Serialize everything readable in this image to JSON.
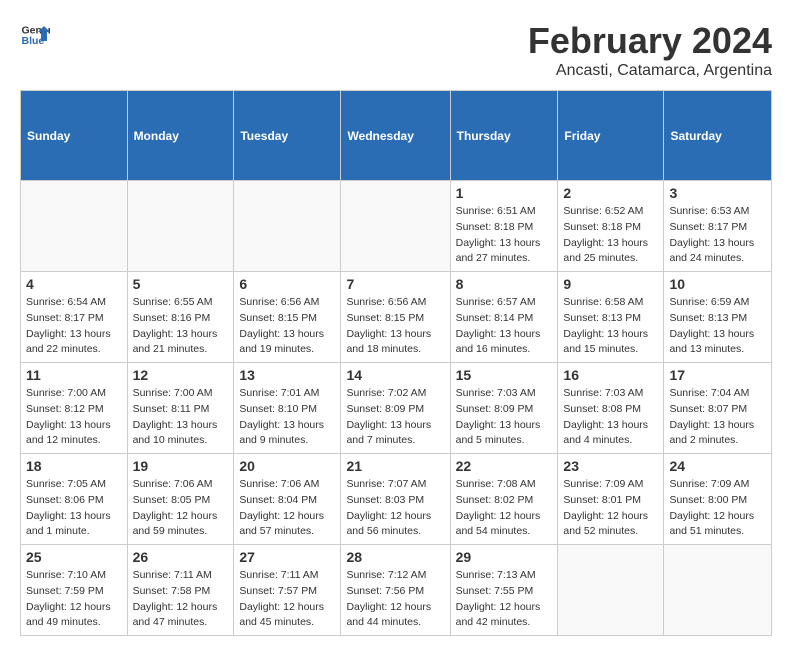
{
  "logo": {
    "line1": "General",
    "line2": "Blue"
  },
  "title": "February 2024",
  "location": "Ancasti, Catamarca, Argentina",
  "headers": [
    "Sunday",
    "Monday",
    "Tuesday",
    "Wednesday",
    "Thursday",
    "Friday",
    "Saturday"
  ],
  "weeks": [
    [
      {
        "day": "",
        "info": ""
      },
      {
        "day": "",
        "info": ""
      },
      {
        "day": "",
        "info": ""
      },
      {
        "day": "",
        "info": ""
      },
      {
        "day": "1",
        "info": "Sunrise: 6:51 AM\nSunset: 8:18 PM\nDaylight: 13 hours\nand 27 minutes."
      },
      {
        "day": "2",
        "info": "Sunrise: 6:52 AM\nSunset: 8:18 PM\nDaylight: 13 hours\nand 25 minutes."
      },
      {
        "day": "3",
        "info": "Sunrise: 6:53 AM\nSunset: 8:17 PM\nDaylight: 13 hours\nand 24 minutes."
      }
    ],
    [
      {
        "day": "4",
        "info": "Sunrise: 6:54 AM\nSunset: 8:17 PM\nDaylight: 13 hours\nand 22 minutes."
      },
      {
        "day": "5",
        "info": "Sunrise: 6:55 AM\nSunset: 8:16 PM\nDaylight: 13 hours\nand 21 minutes."
      },
      {
        "day": "6",
        "info": "Sunrise: 6:56 AM\nSunset: 8:15 PM\nDaylight: 13 hours\nand 19 minutes."
      },
      {
        "day": "7",
        "info": "Sunrise: 6:56 AM\nSunset: 8:15 PM\nDaylight: 13 hours\nand 18 minutes."
      },
      {
        "day": "8",
        "info": "Sunrise: 6:57 AM\nSunset: 8:14 PM\nDaylight: 13 hours\nand 16 minutes."
      },
      {
        "day": "9",
        "info": "Sunrise: 6:58 AM\nSunset: 8:13 PM\nDaylight: 13 hours\nand 15 minutes."
      },
      {
        "day": "10",
        "info": "Sunrise: 6:59 AM\nSunset: 8:13 PM\nDaylight: 13 hours\nand 13 minutes."
      }
    ],
    [
      {
        "day": "11",
        "info": "Sunrise: 7:00 AM\nSunset: 8:12 PM\nDaylight: 13 hours\nand 12 minutes."
      },
      {
        "day": "12",
        "info": "Sunrise: 7:00 AM\nSunset: 8:11 PM\nDaylight: 13 hours\nand 10 minutes."
      },
      {
        "day": "13",
        "info": "Sunrise: 7:01 AM\nSunset: 8:10 PM\nDaylight: 13 hours\nand 9 minutes."
      },
      {
        "day": "14",
        "info": "Sunrise: 7:02 AM\nSunset: 8:09 PM\nDaylight: 13 hours\nand 7 minutes."
      },
      {
        "day": "15",
        "info": "Sunrise: 7:03 AM\nSunset: 8:09 PM\nDaylight: 13 hours\nand 5 minutes."
      },
      {
        "day": "16",
        "info": "Sunrise: 7:03 AM\nSunset: 8:08 PM\nDaylight: 13 hours\nand 4 minutes."
      },
      {
        "day": "17",
        "info": "Sunrise: 7:04 AM\nSunset: 8:07 PM\nDaylight: 13 hours\nand 2 minutes."
      }
    ],
    [
      {
        "day": "18",
        "info": "Sunrise: 7:05 AM\nSunset: 8:06 PM\nDaylight: 13 hours\nand 1 minute."
      },
      {
        "day": "19",
        "info": "Sunrise: 7:06 AM\nSunset: 8:05 PM\nDaylight: 12 hours\nand 59 minutes."
      },
      {
        "day": "20",
        "info": "Sunrise: 7:06 AM\nSunset: 8:04 PM\nDaylight: 12 hours\nand 57 minutes."
      },
      {
        "day": "21",
        "info": "Sunrise: 7:07 AM\nSunset: 8:03 PM\nDaylight: 12 hours\nand 56 minutes."
      },
      {
        "day": "22",
        "info": "Sunrise: 7:08 AM\nSunset: 8:02 PM\nDaylight: 12 hours\nand 54 minutes."
      },
      {
        "day": "23",
        "info": "Sunrise: 7:09 AM\nSunset: 8:01 PM\nDaylight: 12 hours\nand 52 minutes."
      },
      {
        "day": "24",
        "info": "Sunrise: 7:09 AM\nSunset: 8:00 PM\nDaylight: 12 hours\nand 51 minutes."
      }
    ],
    [
      {
        "day": "25",
        "info": "Sunrise: 7:10 AM\nSunset: 7:59 PM\nDaylight: 12 hours\nand 49 minutes."
      },
      {
        "day": "26",
        "info": "Sunrise: 7:11 AM\nSunset: 7:58 PM\nDaylight: 12 hours\nand 47 minutes."
      },
      {
        "day": "27",
        "info": "Sunrise: 7:11 AM\nSunset: 7:57 PM\nDaylight: 12 hours\nand 45 minutes."
      },
      {
        "day": "28",
        "info": "Sunrise: 7:12 AM\nSunset: 7:56 PM\nDaylight: 12 hours\nand 44 minutes."
      },
      {
        "day": "29",
        "info": "Sunrise: 7:13 AM\nSunset: 7:55 PM\nDaylight: 12 hours\nand 42 minutes."
      },
      {
        "day": "",
        "info": ""
      },
      {
        "day": "",
        "info": ""
      }
    ]
  ]
}
